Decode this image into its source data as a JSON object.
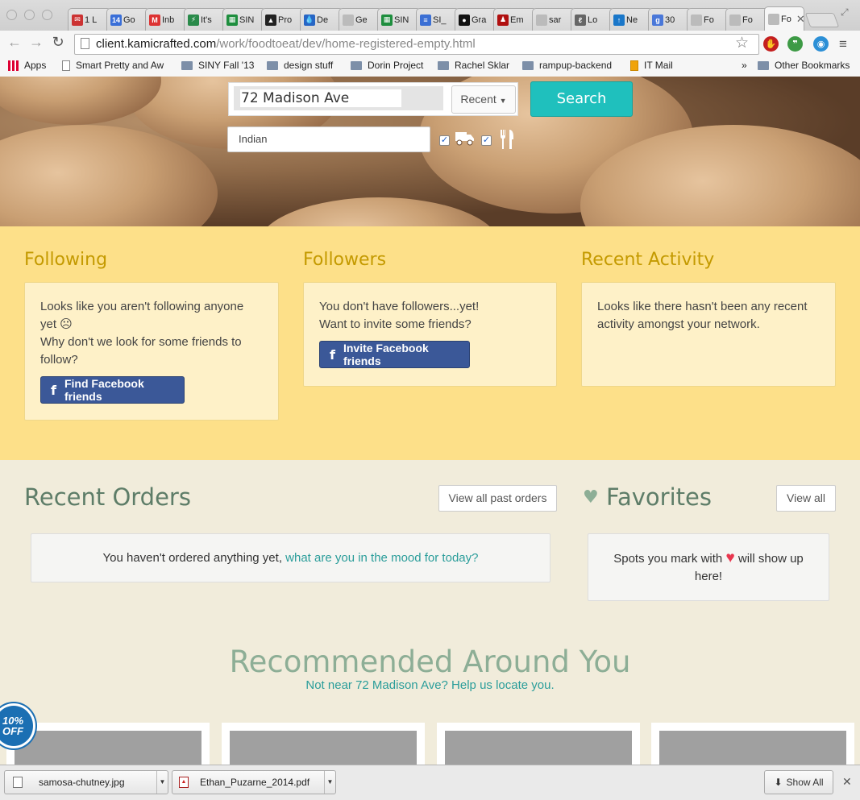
{
  "browser": {
    "tabs": [
      {
        "icon": "gmail-icon",
        "label": "1 L",
        "color": "#cc3333",
        "glyph": "✉"
      },
      {
        "icon": "calendar-icon",
        "label": "Go",
        "color": "#3a6fd8",
        "glyph": "14"
      },
      {
        "icon": "gmail-icon",
        "label": "Inb",
        "color": "#d33",
        "glyph": "M"
      },
      {
        "icon": "bolt-icon",
        "label": "It's",
        "color": "#2a8a4a",
        "glyph": "⚡"
      },
      {
        "icon": "sheets-icon",
        "label": "SIN",
        "color": "#1e8e3e",
        "glyph": "▦"
      },
      {
        "icon": "mountain-icon",
        "label": "Pro",
        "color": "#222",
        "glyph": "▲"
      },
      {
        "icon": "drop-icon",
        "label": "De",
        "color": "#2766c5",
        "glyph": "💧"
      },
      {
        "icon": "doc-icon",
        "label": "Ge",
        "color": "#bbb",
        "glyph": ""
      },
      {
        "icon": "sheets-icon",
        "label": "SIN",
        "color": "#1e8e3e",
        "glyph": "▦"
      },
      {
        "icon": "docs-icon",
        "label": "SI_",
        "color": "#3b6fd4",
        "glyph": "≡"
      },
      {
        "icon": "circle-icon",
        "label": "Gra",
        "color": "#111",
        "glyph": "●"
      },
      {
        "icon": "em-icon",
        "label": "Em",
        "color": "#b01010",
        "glyph": "♟"
      },
      {
        "icon": "doc-icon",
        "label": "sar",
        "color": "#bbb",
        "glyph": ""
      },
      {
        "icon": "lo-icon",
        "label": "Lo",
        "color": "#666",
        "glyph": "ℓ"
      },
      {
        "icon": "arrow-up-icon",
        "label": "Ne",
        "color": "#1a77c9",
        "glyph": "↑"
      },
      {
        "icon": "google-plus-icon",
        "label": "30",
        "color": "#4a78d9",
        "glyph": "g"
      },
      {
        "icon": "doc-icon",
        "label": "Fo",
        "color": "#bbb",
        "glyph": ""
      },
      {
        "icon": "doc-icon",
        "label": "Fo",
        "color": "#bbb",
        "glyph": ""
      },
      {
        "icon": "doc-icon",
        "label": "Fo",
        "color": "#bbb",
        "glyph": ""
      }
    ],
    "url_host": "client.kamicrafted.com",
    "url_path": "/work/foodtoeat/dev/home-registered-empty.html",
    "bookmarks": [
      {
        "label": "Apps",
        "kind": "grid"
      },
      {
        "label": "Smart Pretty and Aw",
        "kind": "doc"
      },
      {
        "label": "SINY Fall '13",
        "kind": "folder"
      },
      {
        "label": "design stuff",
        "kind": "folder"
      },
      {
        "label": "Dorin Project",
        "kind": "folder"
      },
      {
        "label": "Rachel Sklar",
        "kind": "folder"
      },
      {
        "label": "rampup-backend",
        "kind": "folder"
      },
      {
        "label": "IT Mail",
        "kind": "outlook"
      }
    ],
    "bookmarks_overflow": "»",
    "other_bookmarks": "Other Bookmarks"
  },
  "search": {
    "address": "72 Madison Ave",
    "recent_label": "Recent",
    "search_label": "Search",
    "cuisine": "Indian"
  },
  "social": {
    "following": {
      "title": "Following",
      "line1": "Looks like you aren't following anyone yet ☹",
      "line2": "Why don't we look for some friends to follow?",
      "button": "Find Facebook friends"
    },
    "followers": {
      "title": "Followers",
      "line1": "You don't have followers...yet!",
      "line2": "Want to invite some friends?",
      "button": "Invite Facebook friends"
    },
    "activity": {
      "title": "Recent Activity",
      "text": "Looks like there hasn't been any recent activity amongst your network."
    }
  },
  "orders": {
    "title": "Recent Orders",
    "view_all": "View all past orders",
    "empty_text": "You haven't ordered anything yet, ",
    "empty_link": "what are you in the mood for today?"
  },
  "favorites": {
    "title": "Favorites",
    "view_all": "View all",
    "text_before": "Spots you mark with ",
    "text_after": " will show up here!"
  },
  "recommended": {
    "title": "Recommended Around You",
    "subtitle": "Not near 72 Madison Ave? Help us locate you."
  },
  "badge": {
    "line1": "10%",
    "line2": "OFF"
  },
  "downloads": {
    "items": [
      {
        "name": "samosa-chutney.jpg",
        "icon": "image-file-icon"
      },
      {
        "name": "Ethan_Puzarne_2014.pdf",
        "icon": "pdf-file-icon"
      }
    ],
    "show_all": "Show All"
  },
  "colors": {
    "accent_teal": "#1fc0bd",
    "facebook_blue": "#3b5898",
    "social_band": "#fde089",
    "heading_green": "#5e7d68"
  }
}
